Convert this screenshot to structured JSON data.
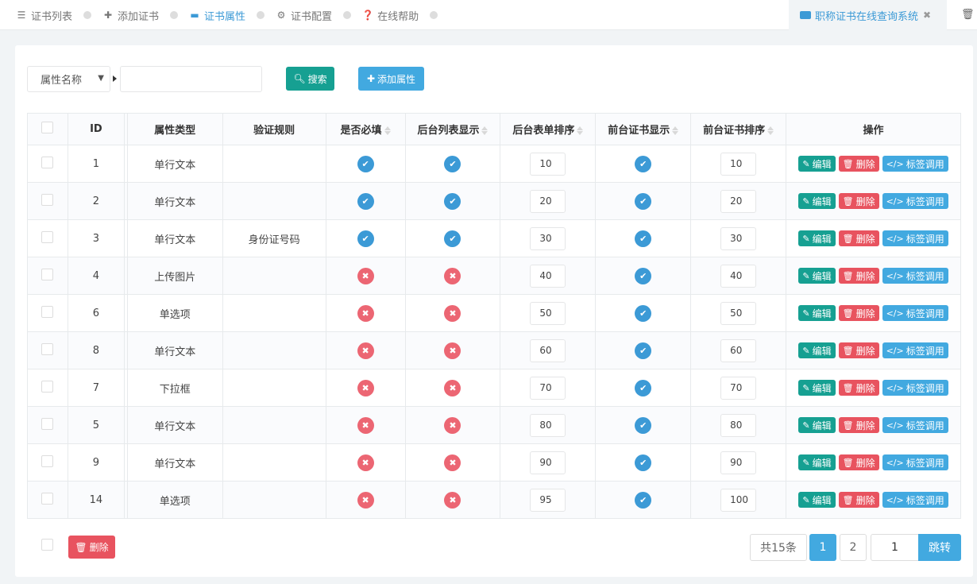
{
  "nav": {
    "items": [
      {
        "label": "证书列表",
        "icon": "list-icon",
        "active": false
      },
      {
        "label": "添加证书",
        "icon": "plus-icon",
        "active": false
      },
      {
        "label": "证书属性",
        "icon": "bars-icon",
        "active": true
      },
      {
        "label": "证书配置",
        "icon": "gear-icon",
        "active": false
      },
      {
        "label": "在线帮助",
        "icon": "question-circle-icon",
        "active": false
      }
    ]
  },
  "window_tab": {
    "title": "职称证书在线查询系统",
    "close": "✖"
  },
  "toolbar": {
    "filter_select": "属性名称",
    "search_value": "",
    "search_label": "搜索",
    "add_label": "添加属性"
  },
  "table": {
    "headers": {
      "id": "ID",
      "type": "属性类型",
      "rule": "验证规则",
      "required": "是否必填",
      "admin_list": "后台列表显示",
      "admin_order": "后台表单排序",
      "front_show": "前台证书显示",
      "front_order": "前台证书排序",
      "ops": "操作"
    },
    "action_labels": {
      "edit": "编辑",
      "delete": "删除",
      "tag": "标签调用"
    },
    "rows": [
      {
        "id": "1",
        "type": "单行文本",
        "rule": "",
        "required": true,
        "admin_list": true,
        "admin_order": "10",
        "front_show": true,
        "front_order": "10"
      },
      {
        "id": "2",
        "type": "单行文本",
        "rule": "",
        "required": true,
        "admin_list": true,
        "admin_order": "20",
        "front_show": true,
        "front_order": "20"
      },
      {
        "id": "3",
        "type": "单行文本",
        "rule": "身份证号码",
        "required": true,
        "admin_list": true,
        "admin_order": "30",
        "front_show": true,
        "front_order": "30"
      },
      {
        "id": "4",
        "type": "上传图片",
        "rule": "",
        "required": false,
        "admin_list": false,
        "admin_order": "40",
        "front_show": true,
        "front_order": "40"
      },
      {
        "id": "6",
        "type": "单选项",
        "rule": "",
        "required": false,
        "admin_list": false,
        "admin_order": "50",
        "front_show": true,
        "front_order": "50"
      },
      {
        "id": "8",
        "type": "单行文本",
        "rule": "",
        "required": false,
        "admin_list": false,
        "admin_order": "60",
        "front_show": true,
        "front_order": "60"
      },
      {
        "id": "7",
        "type": "下拉框",
        "rule": "",
        "required": false,
        "admin_list": false,
        "admin_order": "70",
        "front_show": true,
        "front_order": "70"
      },
      {
        "id": "5",
        "type": "单行文本",
        "rule": "",
        "required": false,
        "admin_list": false,
        "admin_order": "80",
        "front_show": true,
        "front_order": "80"
      },
      {
        "id": "9",
        "type": "单行文本",
        "rule": "",
        "required": false,
        "admin_list": false,
        "admin_order": "90",
        "front_show": true,
        "front_order": "90"
      },
      {
        "id": "14",
        "type": "单选项",
        "rule": "",
        "required": false,
        "admin_list": false,
        "admin_order": "95",
        "front_show": true,
        "front_order": "100"
      }
    ]
  },
  "footer": {
    "bulk_delete_label": "删除",
    "total_label": "共15条",
    "pages": [
      "1",
      "2"
    ],
    "current_page": "1",
    "jump_value": "1",
    "jump_label": "跳转"
  },
  "colors": {
    "primary": "#42a9e0",
    "success": "#16a092",
    "danger": "#e8535f",
    "active_nav": "#3c9ad6"
  }
}
